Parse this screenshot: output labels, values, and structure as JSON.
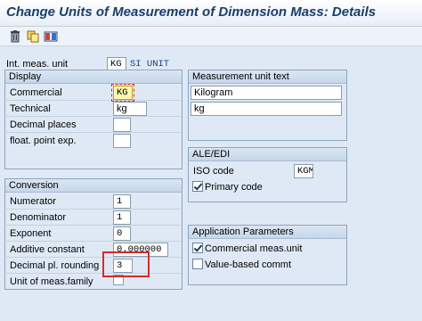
{
  "window": {
    "title": "Change Units of Measurement of Dimension Mass: Details"
  },
  "toolbar": {
    "icons": [
      "trash-icon",
      "copy-icon",
      "other-object-icon"
    ]
  },
  "header": {
    "int_meas_unit_label": "Int. meas. unit",
    "int_meas_unit_value": "KG",
    "si_unit_text": "SI UNIT"
  },
  "display": {
    "title": "Display",
    "commercial_label": "Commercial",
    "commercial_value": "KG",
    "technical_label": "Technical",
    "technical_value": "kg",
    "decimal_places_label": "Decimal places",
    "decimal_places_value": "",
    "float_point_label": "float. point exp.",
    "float_point_value": ""
  },
  "measurement_text": {
    "title": "Measurement unit text",
    "long_text": "Kilogram",
    "short_text": "kg"
  },
  "ale_edi": {
    "title": "ALE/EDI",
    "iso_code_label": "ISO code",
    "iso_code_value": "KGM",
    "primary_code_label": "Primary code",
    "primary_code_checked": true
  },
  "conversion": {
    "title": "Conversion",
    "numerator_label": "Numerator",
    "numerator_value": "1",
    "denominator_label": "Denominator",
    "denominator_value": "1",
    "exponent_label": "Exponent",
    "exponent_value": "0",
    "additive_label": "Additive constant",
    "additive_value": "0.000000",
    "rounding_label": "Decimal pl. rounding",
    "rounding_value": "3",
    "family_label": "Unit of meas.family",
    "family_value": ""
  },
  "app_params": {
    "title": "Application Parameters",
    "commercial_label": "Commercial meas.unit",
    "commercial_checked": true,
    "value_based_label": "Value-based commt",
    "value_based_checked": false
  },
  "colors": {
    "highlight": "#d42b2b",
    "title": "#1a3d6b"
  }
}
